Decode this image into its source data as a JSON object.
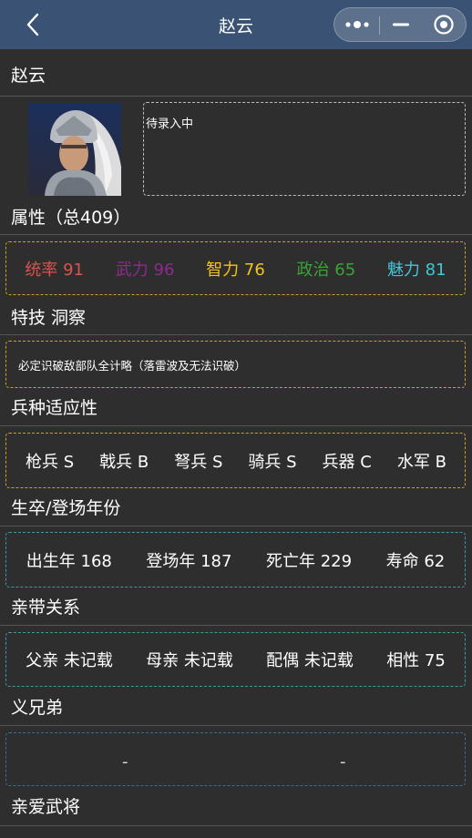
{
  "nav": {
    "title": "赵云",
    "back_icon": "chevron-left-icon",
    "more_icon": "more-dots-icon",
    "minimize_icon": "minimize-icon",
    "close_icon": "target-close-icon"
  },
  "hero": {
    "name": "赵云",
    "description": "待录入中"
  },
  "attributes": {
    "title": "属性（总409）",
    "items": [
      {
        "label": "统率 91",
        "color": "#d9534f"
      },
      {
        "label": "武力 96",
        "color": "#8e2a8e"
      },
      {
        "label": "智力 76",
        "color": "#f0c419"
      },
      {
        "label": "政治 65",
        "color": "#3aa338"
      },
      {
        "label": "魅力 81",
        "color": "#3ec9d6"
      }
    ],
    "border_color": "#c9a227"
  },
  "skill": {
    "title": "特技 洞察",
    "text": "必定识破敌部队全计略（落雷波及无法识破）",
    "border_color": "#c9a227"
  },
  "troops": {
    "title": "兵种适应性",
    "items": [
      "枪兵 S",
      "戟兵 B",
      "弩兵 S",
      "骑兵 S",
      "兵器 C",
      "水军 B"
    ],
    "border_color": "#c9a227"
  },
  "years": {
    "title": "生卒/登场年份",
    "items": [
      "出生年 168",
      "登场年 187",
      "死亡年 229",
      "寿命 62"
    ],
    "border_color": "#3d9aa3"
  },
  "family": {
    "title": "亲带关系",
    "items": [
      "父亲 未记载",
      "母亲 未记载",
      "配偶 未记载",
      "相性 75"
    ],
    "border_color": "#3d9aa3"
  },
  "brothers": {
    "title": "义兄弟",
    "items": [
      "-",
      "-"
    ],
    "border_color": "#3d6f8a"
  },
  "favorites": {
    "title": "亲爱武将"
  }
}
